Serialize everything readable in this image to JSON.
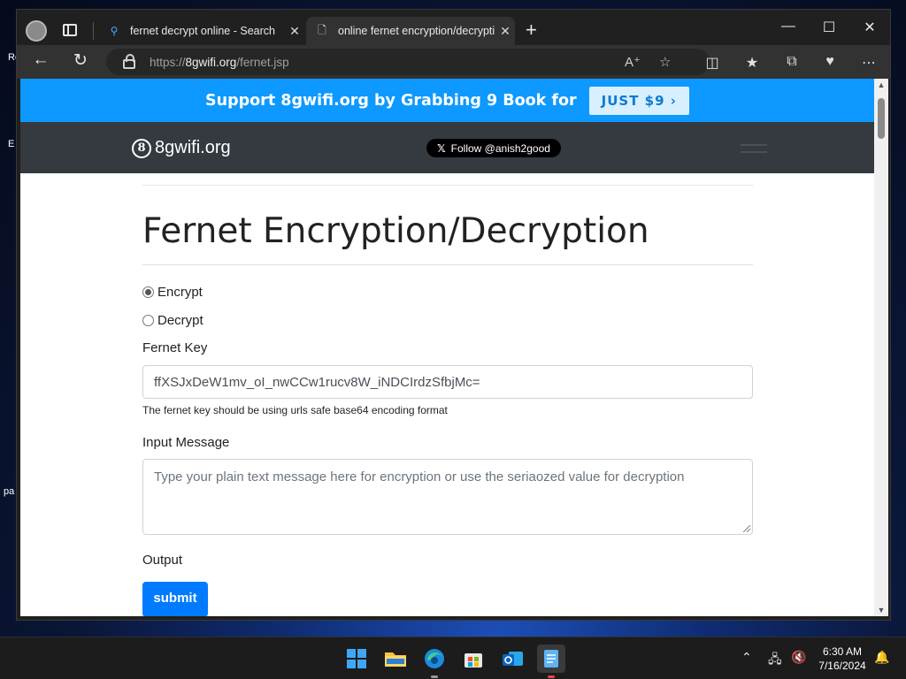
{
  "desktop": {
    "fragments": [
      "Re",
      "E",
      "pa"
    ]
  },
  "browser": {
    "tabs": [
      {
        "title": "fernet decrypt online - Search",
        "icon": "search-icon"
      },
      {
        "title": "online fernet encryption/decrypti",
        "icon": "page-icon"
      }
    ],
    "url": {
      "scheme": "https://",
      "host": "8gwifi.org",
      "path": "/fernet.jsp"
    }
  },
  "page": {
    "promo": {
      "text": "Support 8gwifi.org by Grabbing 9 Book for",
      "button": "JUST $9 ›"
    },
    "site": {
      "brand": "8gwifi.org",
      "brand_mark": "8",
      "follow": "Follow @anish2good",
      "follow_x": "𝕏"
    },
    "title": "Fernet Encryption/Decryption",
    "mode": {
      "options": [
        "Encrypt",
        "Decrypt"
      ],
      "selected": "Encrypt"
    },
    "key": {
      "label": "Fernet Key",
      "value": "ffXSJxDeW1mv_oI_nwCCw1rucv8W_iNDCIrdzSfbjMc=",
      "help": "The fernet key should be using urls safe base64 encoding format"
    },
    "message": {
      "label": "Input Message",
      "placeholder": "Type your plain text message here for encryption or use the seriaozed value for decryption"
    },
    "output": {
      "label": "Output"
    },
    "submit": "submit"
  },
  "taskbar": {
    "apps": [
      "start",
      "file-explorer",
      "edge",
      "microsoft-store",
      "outlook",
      "notepad"
    ],
    "clock": {
      "time": "6:30 AM",
      "date": "7/16/2024"
    }
  }
}
